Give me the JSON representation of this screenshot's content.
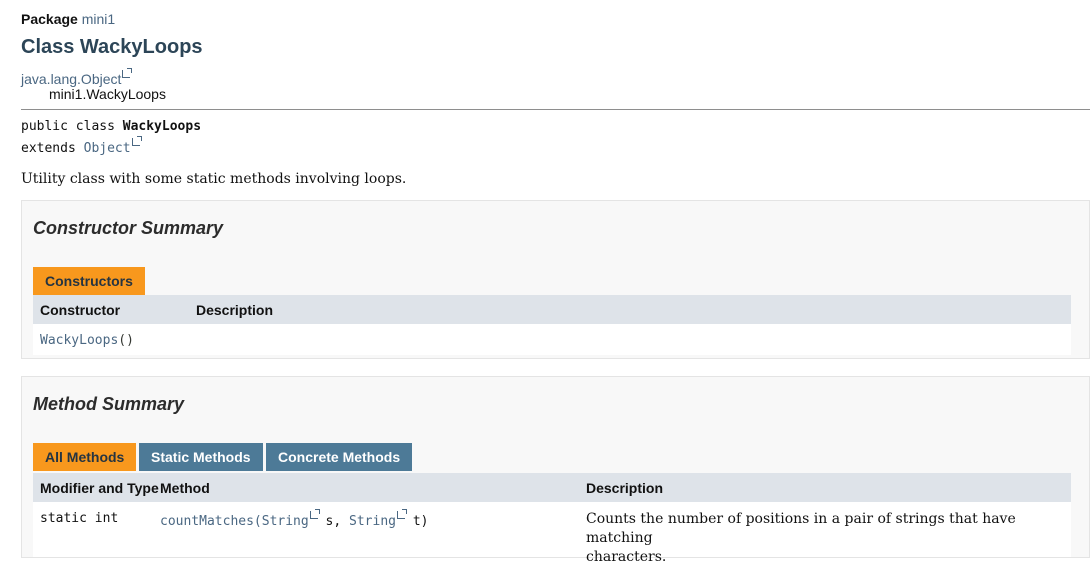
{
  "header": {
    "package_label": "Package",
    "package_name": "mini1",
    "class_title": "Class WackyLoops",
    "inheritance_parent": "java.lang.Object",
    "inheritance_child": "mini1.WackyLoops"
  },
  "signature": {
    "line1_prefix": "public class ",
    "line1_name": "WackyLoops",
    "line2_prefix": "extends ",
    "line2_link": "Object"
  },
  "description": "Utility class with some static methods involving loops.",
  "constructor_summary": {
    "heading": "Constructor Summary",
    "tab_label": "Constructors",
    "columns": [
      "Constructor",
      "Description"
    ],
    "rows": [
      {
        "name": "WackyLoops",
        "params": "()",
        "description": ""
      }
    ]
  },
  "method_summary": {
    "heading": "Method Summary",
    "tabs": [
      "All Methods",
      "Static Methods",
      "Concrete Methods"
    ],
    "columns": [
      "Modifier and Type",
      "Method",
      "Description"
    ],
    "rows": [
      {
        "modifier": "static int",
        "method_name": "countMatches",
        "param1_type": "String",
        "param1_name": " s, ",
        "param2_type": "String",
        "param2_name": " t)",
        "description_line1": "Counts the number of positions in a pair of strings that have matching",
        "description_line2": "characters."
      }
    ]
  },
  "colors": {
    "active_tab": "#f8981d",
    "inactive_tab": "#4d7a97",
    "table_header": "#dee3e9",
    "link": "#4a6782"
  }
}
